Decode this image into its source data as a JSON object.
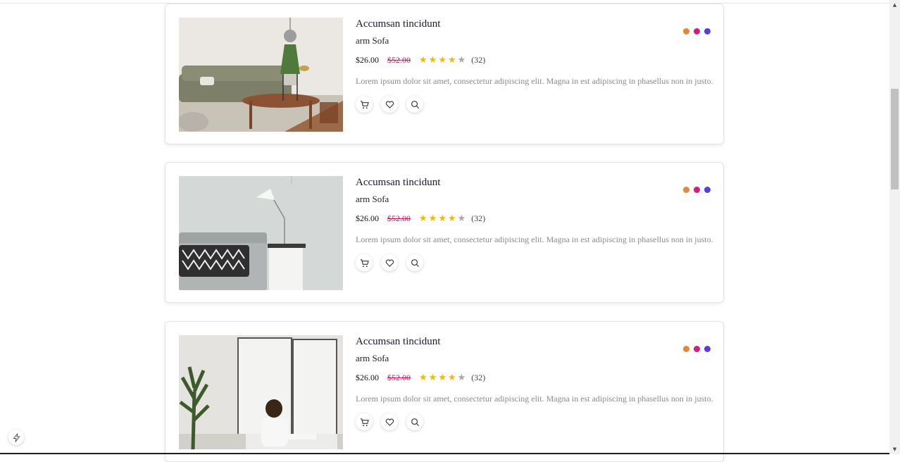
{
  "products": [
    {
      "title": "Accumsan tincidunt",
      "subtitle": "arm Sofa",
      "price": "$26.00",
      "old_price": "$52.00",
      "rating": 4,
      "review_count": "(32)",
      "description": "Lorem ipsum dolor sit amet, consectetur adipiscing elit. Magna in est adipiscing in phasellus non in justo.",
      "image": "living-room-sofa-photo",
      "colors": [
        "#e0893a",
        "#d81b7a",
        "#5b3be0"
      ]
    },
    {
      "title": "Accumsan tincidunt",
      "subtitle": "arm Sofa",
      "price": "$26.00",
      "old_price": "$52.00",
      "rating": 4,
      "review_count": "(32)",
      "description": "Lorem ipsum dolor sit amet, consectetur adipiscing elit. Magna in est adipiscing in phasellus non in justo.",
      "image": "grey-sofa-lamp-photo",
      "colors": [
        "#e0893a",
        "#d81b7a",
        "#5b3be0"
      ]
    },
    {
      "title": "Accumsan tincidunt",
      "subtitle": "arm Sofa",
      "price": "$26.00",
      "old_price": "$52.00",
      "rating": 4,
      "review_count": "(32)",
      "description": "Lorem ipsum dolor sit amet, consectetur adipiscing elit. Magna in est adipiscing in phasellus non in justo.",
      "image": "man-on-sofa-photo",
      "colors": [
        "#e0893a",
        "#d81b7a",
        "#5b3be0"
      ]
    }
  ],
  "icons": {
    "cart": "cart-icon",
    "wishlist": "heart-icon",
    "quick_view": "search-icon",
    "floating": "bolt-icon"
  }
}
